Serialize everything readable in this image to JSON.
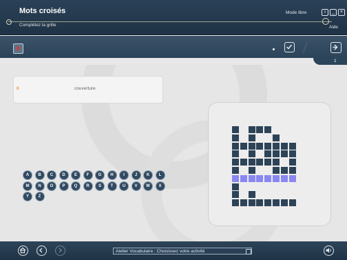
{
  "header": {
    "title": "Mots croisés",
    "subtitle": "Complétez la grille",
    "mode_label": "Mode libre",
    "help_label": "Aide"
  },
  "toolbar": {
    "page_number": "1"
  },
  "clue": {
    "number": "8",
    "text": "couverture"
  },
  "alphabet": {
    "row1": [
      "A",
      "B",
      "C",
      "D",
      "E",
      "F",
      "G",
      "H",
      "I",
      "J",
      "K",
      "L"
    ],
    "row2": [
      "M",
      "N",
      "O",
      "P",
      "Q",
      "R",
      "S",
      "T",
      "U",
      "V",
      "W",
      "X"
    ],
    "row3": [
      "Y",
      "Z"
    ]
  },
  "footer": {
    "status_text": "Atelier Vocabulaire : Choisissez votre activité"
  },
  "colors": {
    "header_bg": "#2b4157",
    "grid_cell": "#2d4358",
    "highlight_cell": "#8a86f2",
    "letter_button": "#324a61",
    "clue_number": "#e07a1c"
  },
  "icons": {
    "home": "home-icon",
    "back": "back-arrow-icon",
    "forward": "forward-arrow-icon",
    "sound": "speaker-icon",
    "validate": "check-icon",
    "next": "next-arrow-icon",
    "book": "book-icon"
  }
}
